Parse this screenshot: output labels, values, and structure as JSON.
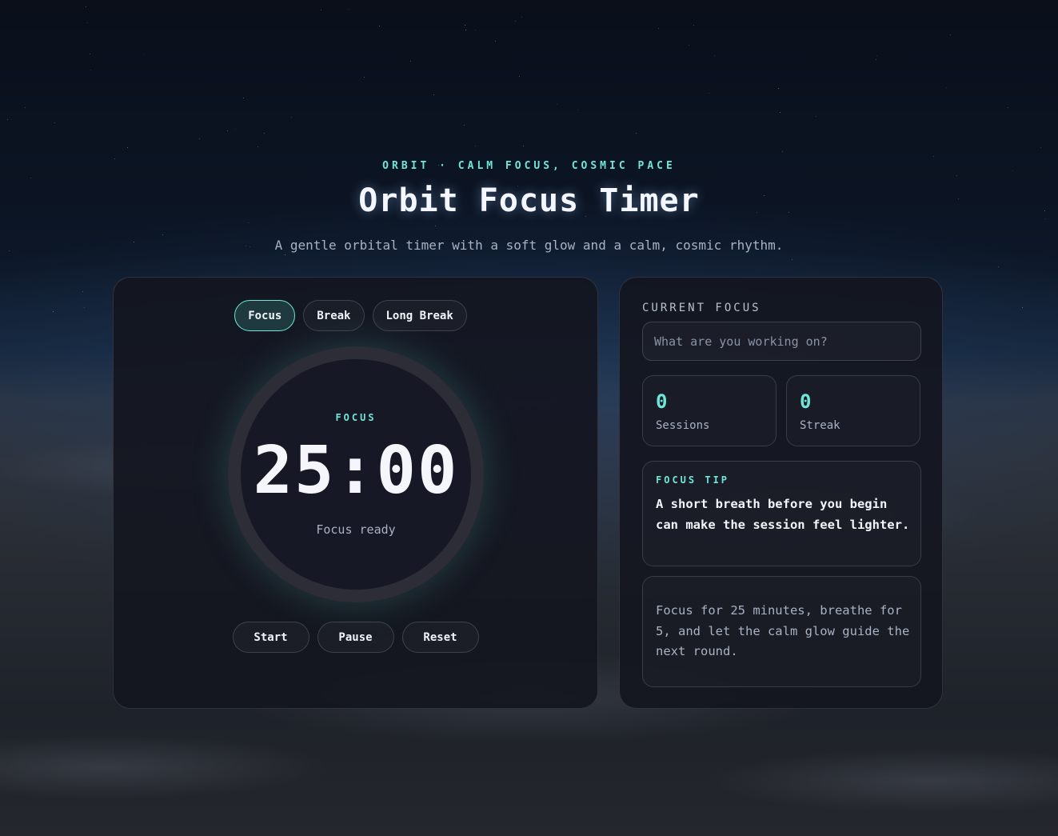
{
  "header": {
    "eyebrow": "ORBIT · CALM FOCUS, COSMIC PACE",
    "title": "Orbit Focus Timer",
    "subtitle": "A gentle orbital timer with a soft glow and a calm, cosmic rhythm."
  },
  "timer": {
    "modes": [
      {
        "label": "Focus",
        "active": true
      },
      {
        "label": "Break",
        "active": false
      },
      {
        "label": "Long Break",
        "active": false
      }
    ],
    "mode_label": "FOCUS",
    "time": "25:00",
    "status": "Focus ready",
    "controls": {
      "start": "Start",
      "pause": "Pause",
      "reset": "Reset"
    }
  },
  "side": {
    "section_label": "CURRENT FOCUS",
    "input": {
      "placeholder": "What are you working on?",
      "value": ""
    },
    "stats": [
      {
        "value": "0",
        "label": "Sessions"
      },
      {
        "value": "0",
        "label": "Streak"
      }
    ],
    "tip": {
      "label": "FOCUS TIP",
      "text": "A short breath before you begin can make the session feel lighter."
    },
    "note": "Focus for 25 minutes, breathe for 5, and let the calm glow guide the next round."
  },
  "colors": {
    "accent": "#6ee7d8",
    "panel": "#14161f",
    "text": "#f4f6fb",
    "muted": "#a9b2c3"
  }
}
